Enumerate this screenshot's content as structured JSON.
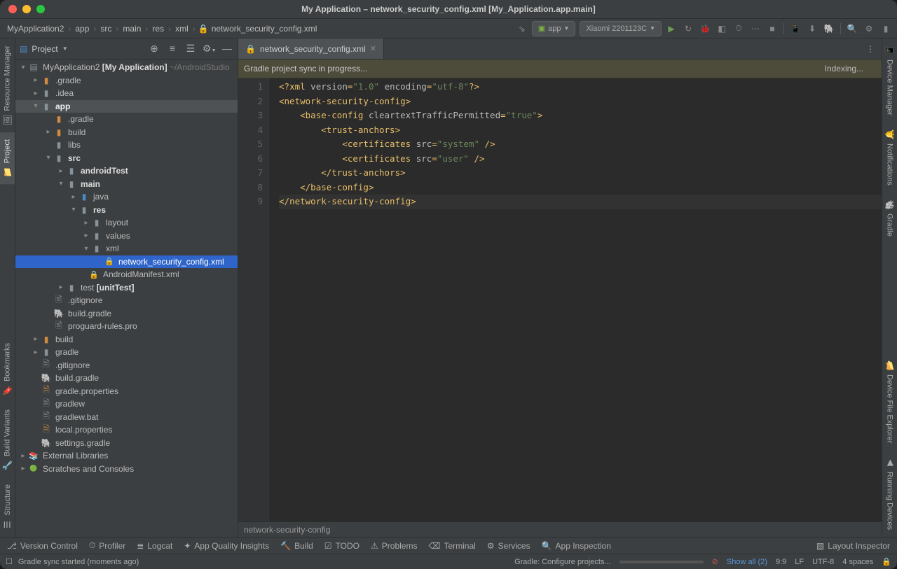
{
  "window": {
    "title": "My Application – network_security_config.xml [My_Application.app.main]"
  },
  "breadcrumbs": [
    "MyApplication2",
    "app",
    "src",
    "main",
    "res",
    "xml",
    "network_security_config.xml"
  ],
  "runconfig": {
    "app": "app",
    "device": "Xiaomi 2201123C"
  },
  "projectPane": {
    "title": "Project"
  },
  "tree": {
    "root": {
      "name": "MyApplication2",
      "hint": "[My Application]",
      "loc": "~/AndroidStudio"
    },
    "gradle": ".gradle",
    "idea": ".idea",
    "app": "app",
    "app_gradle": ".gradle",
    "app_build": "build",
    "app_libs": "libs",
    "app_src": "src",
    "androidTest": "androidTest",
    "main": "main",
    "java": "java",
    "res": "res",
    "layout": "layout",
    "values": "values",
    "xml": "xml",
    "nsc": "network_security_config.xml",
    "manifest": "AndroidManifest.xml",
    "test": "test",
    "test_hint": "[unitTest]",
    "gitignore": ".gitignore",
    "buildgradle": "build.gradle",
    "proguard": "proguard-rules.pro",
    "build": "build",
    "gradleDir": "gradle",
    "gitignore2": ".gitignore",
    "buildgradle2": "build.gradle",
    "gradleprops": "gradle.properties",
    "gradlew": "gradlew",
    "gradlewbat": "gradlew.bat",
    "localprops": "local.properties",
    "settingsgradle": "settings.gradle",
    "extlib": "External Libraries",
    "scratches": "Scratches and Consoles"
  },
  "tab": {
    "name": "network_security_config.xml"
  },
  "banner": {
    "msg": "Gradle project sync in progress...",
    "indexing": "Indexing..."
  },
  "code": {
    "lines": [
      "1",
      "2",
      "3",
      "4",
      "5",
      "6",
      "7",
      "8",
      "9"
    ],
    "breadcrumb": "network-security-config"
  },
  "rails": {
    "left": [
      {
        "label": "Resource Manager",
        "icon": "🖼"
      },
      {
        "label": "Project",
        "icon": "📁",
        "active": true
      },
      {
        "label": "Bookmarks",
        "icon": "🔖"
      },
      {
        "label": "Build Variants",
        "icon": "🔧"
      },
      {
        "label": "Structure",
        "icon": "☰"
      }
    ],
    "right": [
      {
        "label": "Device Manager",
        "icon": "📱"
      },
      {
        "label": "Notifications",
        "icon": "🔔"
      },
      {
        "label": "Gradle",
        "icon": "🐘"
      },
      {
        "label": "Device File Explorer",
        "icon": "📂"
      },
      {
        "label": "Running Devices",
        "icon": "▶"
      }
    ]
  },
  "bottom": {
    "vc": "Version Control",
    "profiler": "Profiler",
    "logcat": "Logcat",
    "aqi": "App Quality Insights",
    "build": "Build",
    "todo": "TODO",
    "problems": "Problems",
    "terminal": "Terminal",
    "services": "Services",
    "appinsp": "App Inspection",
    "layoutinsp": "Layout Inspector"
  },
  "status": {
    "sync": "Gradle sync started (moments ago)",
    "progress": "Gradle: Configure projects...",
    "showall": "Show all (2)",
    "pos": "9:9",
    "eol": "LF",
    "enc": "UTF-8",
    "indent": "4 spaces"
  }
}
